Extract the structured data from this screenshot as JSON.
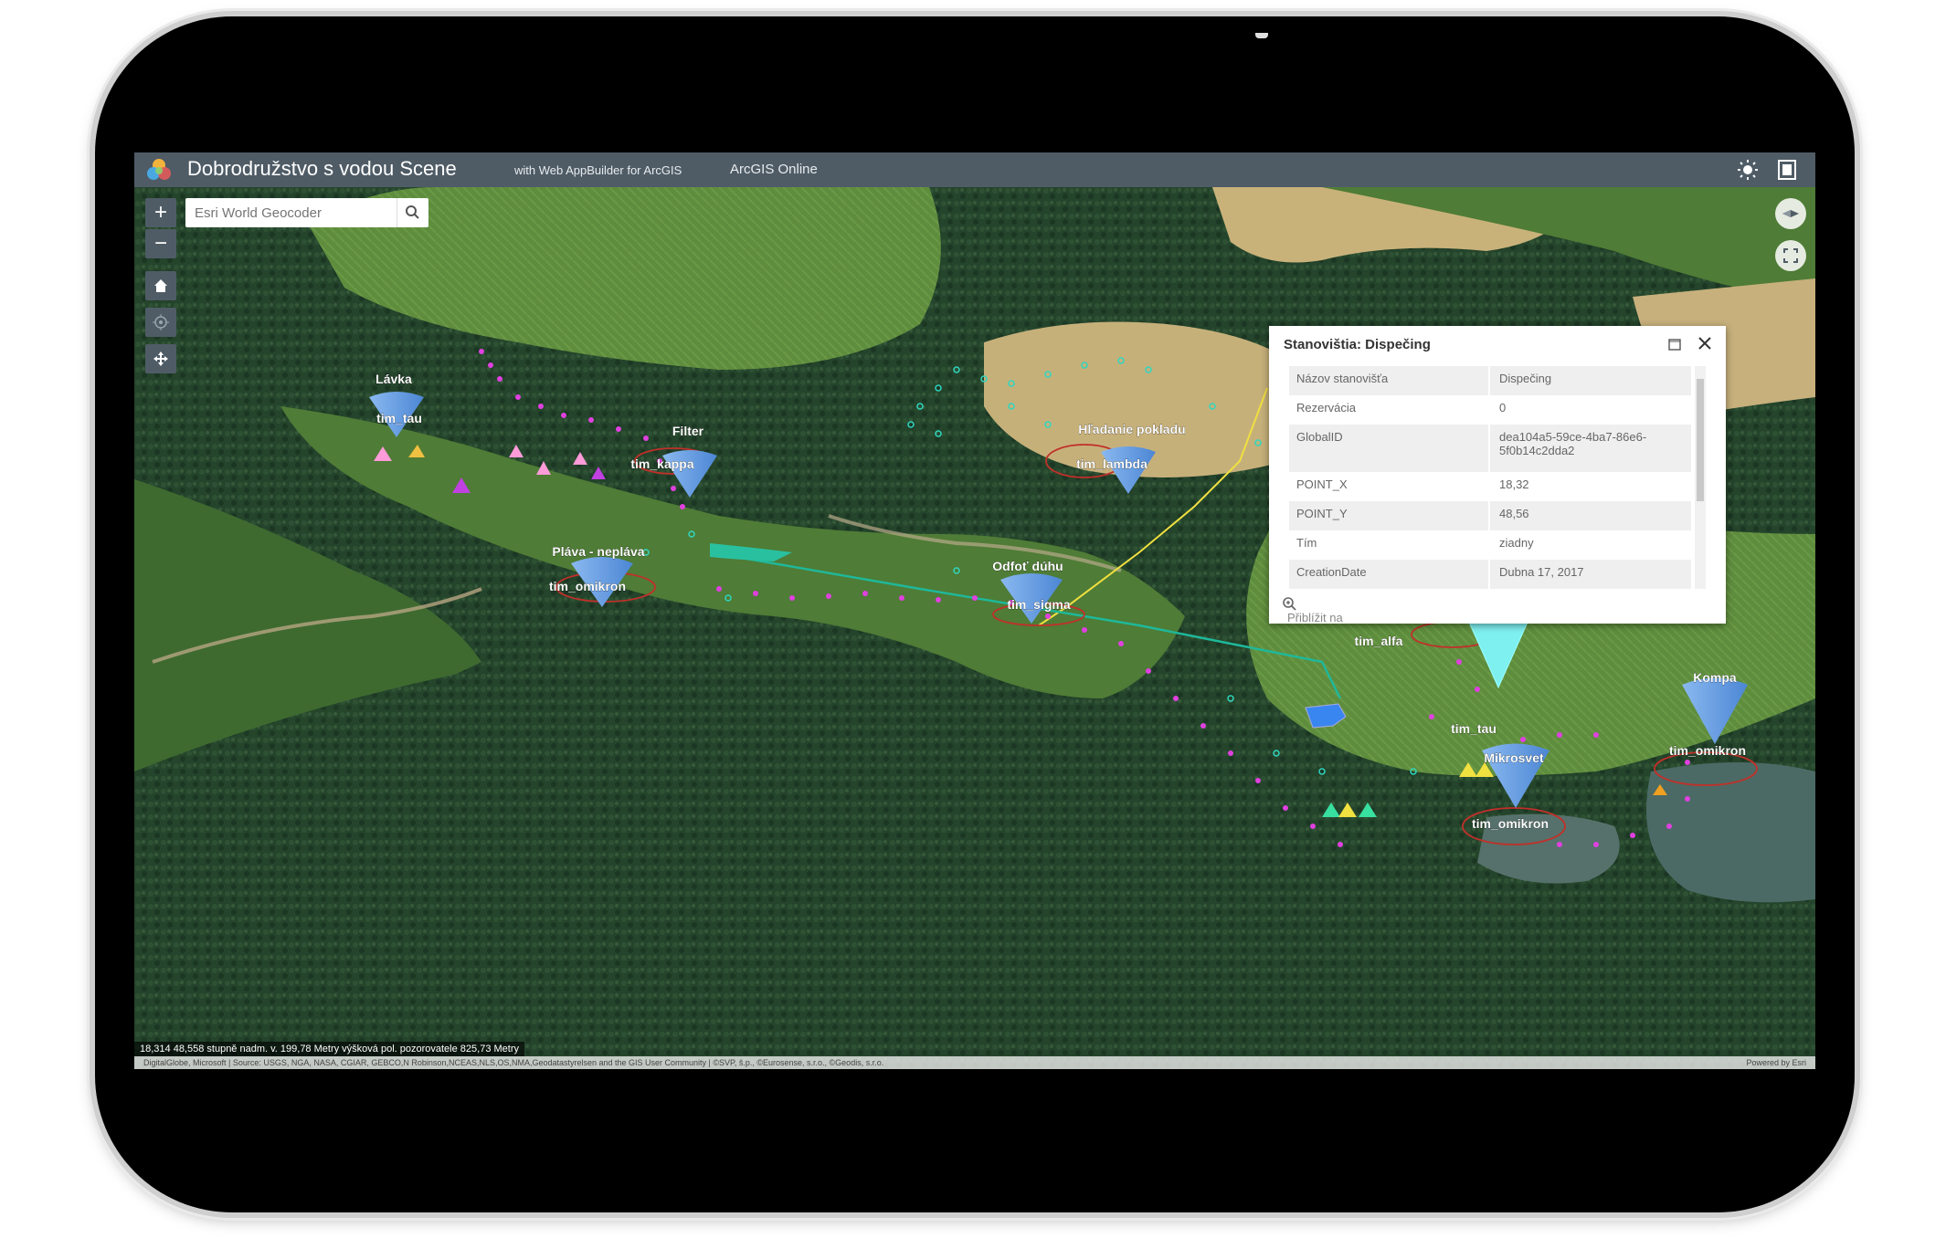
{
  "header": {
    "title": "Dobrodružstvo s vodou Scene",
    "subtitle": "with Web AppBuilder for ArcGIS",
    "link": "ArcGIS Online"
  },
  "map": {
    "search": {
      "placeholder": "Esri World Geocoder"
    },
    "zoom_in": "+",
    "zoom_out": "−",
    "station_labels": [
      {
        "name": "Lávka",
        "team": "tim_tau"
      },
      {
        "name": "Filter",
        "team": "tim_kappa"
      },
      {
        "name": "Hľadanie pokladu",
        "team": "tim_lambda"
      },
      {
        "name": "Pláva - nepláva",
        "team": "tim_omikron"
      },
      {
        "name": "Odfoť dúhu",
        "team": "tim_sigma"
      },
      {
        "name": "",
        "team": "tim_alfa"
      },
      {
        "name": "Kompa",
        "team": "tim_omikron"
      },
      {
        "name": "Mikrosvet",
        "team": "tim_omikron"
      },
      {
        "name": "",
        "team": "tim_tau"
      }
    ],
    "coordinates": "18,314 48,558 stupně   nadm. v. 199,78 Metry   výšková pol. pozorovatele 825,73 Metry",
    "attribution": "DigitalGlobe, Microsoft | Source: USGS, NGA, NASA, CGIAR, GEBCO,N Robinson,NCEAS,NLS,OS,NMA,Geodatastyrelsen and the GIS User Community | ©SVP, š.p., ©Eurosense, s.r.o., ©Geodis, s.r.o.",
    "powered_by": "Powered by Esri"
  },
  "popup": {
    "title": "Stanovištia: Dispečing",
    "rows": [
      {
        "key": "Názov stanovišťa",
        "value": "Dispečing"
      },
      {
        "key": "Rezervácia",
        "value": "0"
      },
      {
        "key": "GlobalID",
        "value": "dea104a5-59ce-4ba7-86e6-5f0b14c2dda2"
      },
      {
        "key": "POINT_X",
        "value": "18,32"
      },
      {
        "key": "POINT_Y",
        "value": "48,56"
      },
      {
        "key": "Tím",
        "value": "ziadny"
      },
      {
        "key": "CreationDate",
        "value": "Dubna 17, 2017"
      }
    ],
    "zoom_to": "Přiblížit na"
  },
  "colors": {
    "header": "#4f5c66",
    "station_cone": "#6fa6e8",
    "track_magenta": "#e040e0",
    "track_teal": "#2fd6c0",
    "route_yellow": "#f0e040"
  }
}
